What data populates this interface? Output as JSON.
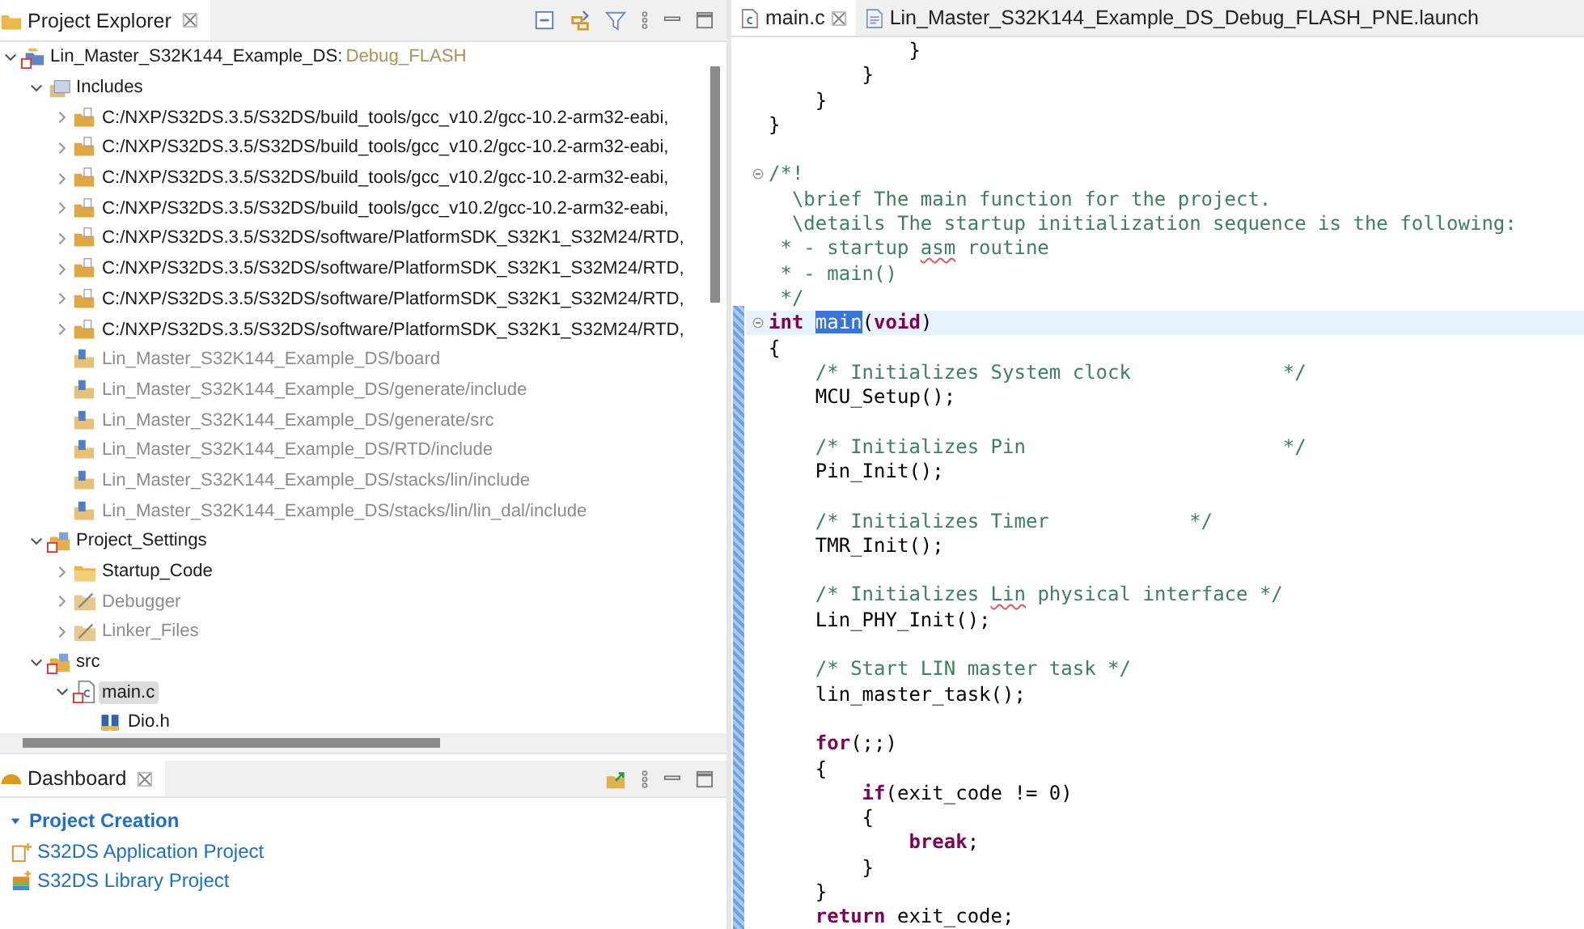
{
  "explorer": {
    "title": "Project Explorer",
    "tree": [
      {
        "label": "Lin_Master_S32K144_Example_DS:",
        "config": "Debug_FLASH",
        "kind": "project",
        "expanded": true,
        "dimmed": false,
        "selected": false,
        "children": [
          {
            "label": "Includes",
            "kind": "includes",
            "expanded": true,
            "dimmed": false,
            "selected": false,
            "children": [
              {
                "label": "C:/NXP/S32DS.3.5/S32DS/build_tools/gcc_v10.2/gcc-10.2-arm32-eabi,",
                "kind": "include-path",
                "expanded": false,
                "dimmed": false,
                "selected": false
              },
              {
                "label": "C:/NXP/S32DS.3.5/S32DS/build_tools/gcc_v10.2/gcc-10.2-arm32-eabi,",
                "kind": "include-path",
                "expanded": false,
                "dimmed": false,
                "selected": false
              },
              {
                "label": "C:/NXP/S32DS.3.5/S32DS/build_tools/gcc_v10.2/gcc-10.2-arm32-eabi,",
                "kind": "include-path",
                "expanded": false,
                "dimmed": false,
                "selected": false
              },
              {
                "label": "C:/NXP/S32DS.3.5/S32DS/build_tools/gcc_v10.2/gcc-10.2-arm32-eabi,",
                "kind": "include-path",
                "expanded": false,
                "dimmed": false,
                "selected": false
              },
              {
                "label": "C:/NXP/S32DS.3.5/S32DS/software/PlatformSDK_S32K1_S32M24/RTD,",
                "kind": "include-path",
                "expanded": false,
                "dimmed": false,
                "selected": false
              },
              {
                "label": "C:/NXP/S32DS.3.5/S32DS/software/PlatformSDK_S32K1_S32M24/RTD,",
                "kind": "include-path",
                "expanded": false,
                "dimmed": false,
                "selected": false
              },
              {
                "label": "C:/NXP/S32DS.3.5/S32DS/software/PlatformSDK_S32K1_S32M24/RTD,",
                "kind": "include-path",
                "expanded": false,
                "dimmed": false,
                "selected": false
              },
              {
                "label": "C:/NXP/S32DS.3.5/S32DS/software/PlatformSDK_S32K1_S32M24/RTD,",
                "kind": "include-path",
                "expanded": false,
                "dimmed": false,
                "selected": false
              },
              {
                "label": "Lin_Master_S32K144_Example_DS/board",
                "kind": "workspace-path",
                "dimmed": true,
                "selected": false
              },
              {
                "label": "Lin_Master_S32K144_Example_DS/generate/include",
                "kind": "workspace-path",
                "dimmed": true,
                "selected": false
              },
              {
                "label": "Lin_Master_S32K144_Example_DS/generate/src",
                "kind": "workspace-path",
                "dimmed": true,
                "selected": false
              },
              {
                "label": "Lin_Master_S32K144_Example_DS/RTD/include",
                "kind": "workspace-path",
                "dimmed": true,
                "selected": false
              },
              {
                "label": "Lin_Master_S32K144_Example_DS/stacks/lin/include",
                "kind": "workspace-path",
                "dimmed": true,
                "selected": false
              },
              {
                "label": "Lin_Master_S32K144_Example_DS/stacks/lin/lin_dal/include",
                "kind": "workspace-path",
                "dimmed": true,
                "selected": false
              }
            ]
          },
          {
            "label": "Project_Settings",
            "kind": "source-folder",
            "expanded": true,
            "dimmed": false,
            "selected": false,
            "children": [
              {
                "label": "Startup_Code",
                "kind": "folder",
                "expanded": false,
                "dimmed": false,
                "selected": false
              },
              {
                "label": "Debugger",
                "kind": "excluded-folder",
                "expanded": false,
                "dimmed": true,
                "selected": false
              },
              {
                "label": "Linker_Files",
                "kind": "excluded-folder",
                "expanded": false,
                "dimmed": true,
                "selected": false
              }
            ]
          },
          {
            "label": "src",
            "kind": "source-folder",
            "expanded": true,
            "dimmed": false,
            "selected": false,
            "children": [
              {
                "label": "main.c",
                "kind": "c-file",
                "expanded": true,
                "dimmed": false,
                "selected": true,
                "children": [
                  {
                    "label": "Dio.h",
                    "kind": "header",
                    "dimmed": false,
                    "selected": false
                  }
                ]
              }
            ]
          }
        ]
      }
    ]
  },
  "dashboard": {
    "title": "Dashboard",
    "section": {
      "title": "Project Creation",
      "expanded": true,
      "links": [
        {
          "label": "S32DS Application Project",
          "kind": "application"
        },
        {
          "label": "S32DS Library Project",
          "kind": "library"
        }
      ]
    }
  },
  "editor": {
    "tabs": [
      {
        "label": "main.c",
        "kind": "c-file",
        "selected": true
      },
      {
        "label": "Lin_Master_S32K144_Example_DS_Debug_FLASH_PNE.launch",
        "kind": "launch",
        "selected": false
      }
    ],
    "lines": [
      {
        "kind": "code",
        "tokens": [
          {
            "text": "            }",
            "kind": "plain"
          }
        ]
      },
      {
        "kind": "code",
        "tokens": [
          {
            "text": "        }",
            "kind": "plain"
          }
        ]
      },
      {
        "kind": "code",
        "tokens": [
          {
            "text": "    }",
            "kind": "plain"
          }
        ]
      },
      {
        "kind": "code",
        "tokens": [
          {
            "text": "}",
            "kind": "plain"
          }
        ]
      },
      {
        "kind": "blank"
      },
      {
        "kind": "code",
        "fold": true,
        "tokens": [
          {
            "text": "/*!",
            "kind": "comment"
          }
        ]
      },
      {
        "kind": "code",
        "tokens": [
          {
            "text": "  \\brief The main function for the project.",
            "kind": "comment"
          }
        ]
      },
      {
        "kind": "code",
        "tokens": [
          {
            "text": "  \\details The startup initialization sequence is the following:",
            "kind": "comment"
          }
        ]
      },
      {
        "kind": "code",
        "tokens": [
          {
            "text": " * - startup ",
            "kind": "comment"
          },
          {
            "text": "asm",
            "kind": "misspelled"
          },
          {
            "text": " routine",
            "kind": "comment"
          }
        ]
      },
      {
        "kind": "code",
        "tokens": [
          {
            "text": " * - main()",
            "kind": "comment"
          }
        ]
      },
      {
        "kind": "code",
        "tokens": [
          {
            "text": " */",
            "kind": "comment"
          }
        ]
      },
      {
        "kind": "code",
        "fold": true,
        "current": true,
        "tokens": [
          {
            "text": "int ",
            "kind": "keyword"
          },
          {
            "text": "main",
            "kind": "selection"
          },
          {
            "text": "(",
            "kind": "plain"
          },
          {
            "text": "void",
            "kind": "keyword"
          },
          {
            "text": ")",
            "kind": "plain"
          }
        ]
      },
      {
        "kind": "code",
        "tokens": [
          {
            "text": "{",
            "kind": "plain"
          }
        ]
      },
      {
        "kind": "code",
        "tokens": [
          {
            "text": "    /* Initializes System clock             */",
            "kind": "comment"
          }
        ]
      },
      {
        "kind": "code",
        "tokens": [
          {
            "text": "    MCU_Setup();",
            "kind": "plain"
          }
        ]
      },
      {
        "kind": "blank"
      },
      {
        "kind": "code",
        "tokens": [
          {
            "text": "    /* Initializes Pin                      */",
            "kind": "comment"
          }
        ]
      },
      {
        "kind": "code",
        "tokens": [
          {
            "text": "    Pin_Init();",
            "kind": "plain"
          }
        ]
      },
      {
        "kind": "blank"
      },
      {
        "kind": "code",
        "tokens": [
          {
            "text": "    /* Initializes Timer            */",
            "kind": "comment"
          }
        ]
      },
      {
        "kind": "code",
        "tokens": [
          {
            "text": "    TMR_Init();",
            "kind": "plain"
          }
        ]
      },
      {
        "kind": "blank"
      },
      {
        "kind": "code",
        "tokens": [
          {
            "text": "    /* Initializes ",
            "kind": "comment"
          },
          {
            "text": "Lin",
            "kind": "misspelled"
          },
          {
            "text": " physical interface */",
            "kind": "comment"
          }
        ]
      },
      {
        "kind": "code",
        "tokens": [
          {
            "text": "    Lin_PHY_Init();",
            "kind": "plain"
          }
        ]
      },
      {
        "kind": "blank"
      },
      {
        "kind": "code",
        "tokens": [
          {
            "text": "    /* Start LIN master task */",
            "kind": "comment"
          }
        ]
      },
      {
        "kind": "code",
        "tokens": [
          {
            "text": "    lin_master_task();",
            "kind": "plain"
          }
        ]
      },
      {
        "kind": "blank"
      },
      {
        "kind": "code",
        "tokens": [
          {
            "text": "    for",
            "kind": "keyword"
          },
          {
            "text": "(;;)",
            "kind": "plain"
          }
        ]
      },
      {
        "kind": "code",
        "tokens": [
          {
            "text": "    {",
            "kind": "plain"
          }
        ]
      },
      {
        "kind": "code",
        "tokens": [
          {
            "text": "        if",
            "kind": "keyword"
          },
          {
            "text": "(exit_code != 0)",
            "kind": "plain"
          }
        ]
      },
      {
        "kind": "code",
        "tokens": [
          {
            "text": "        {",
            "kind": "plain"
          }
        ]
      },
      {
        "kind": "code",
        "tokens": [
          {
            "text": "            break",
            "kind": "keyword"
          },
          {
            "text": ";",
            "kind": "plain"
          }
        ]
      },
      {
        "kind": "code",
        "tokens": [
          {
            "text": "        }",
            "kind": "plain"
          }
        ]
      },
      {
        "kind": "code",
        "tokens": [
          {
            "text": "    }",
            "kind": "plain"
          }
        ]
      },
      {
        "kind": "code",
        "tokens": [
          {
            "text": "    return",
            "kind": "keyword"
          },
          {
            "text": " exit_code;",
            "kind": "plain"
          }
        ]
      }
    ]
  }
}
